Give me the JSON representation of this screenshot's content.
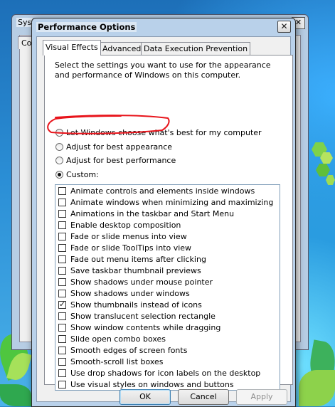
{
  "background_window": {
    "title": "Sys",
    "close_glyph": "✕",
    "tab_fragment": "Co"
  },
  "dialog": {
    "title": "Performance Options",
    "close_glyph": "✕",
    "tabs": [
      {
        "label": "Visual Effects",
        "active": true
      },
      {
        "label": "Advanced",
        "active": false
      },
      {
        "label": "Data Execution Prevention",
        "active": false
      }
    ],
    "description": "Select the settings you want to use for the appearance and performance of Windows on this computer.",
    "radio_options": [
      {
        "label": "Let Windows choose what's best for my computer",
        "checked": false
      },
      {
        "label": "Adjust for best appearance",
        "checked": false
      },
      {
        "label": "Adjust for best performance",
        "checked": false
      },
      {
        "label": "Custom:",
        "checked": true
      }
    ],
    "effects": [
      {
        "label": "Animate controls and elements inside windows",
        "checked": false
      },
      {
        "label": "Animate windows when minimizing and maximizing",
        "checked": false
      },
      {
        "label": "Animations in the taskbar and Start Menu",
        "checked": false
      },
      {
        "label": "Enable desktop composition",
        "checked": false
      },
      {
        "label": "Fade or slide menus into view",
        "checked": false
      },
      {
        "label": "Fade or slide ToolTips into view",
        "checked": false
      },
      {
        "label": "Fade out menu items after clicking",
        "checked": false
      },
      {
        "label": "Save taskbar thumbnail previews",
        "checked": false
      },
      {
        "label": "Show shadows under mouse pointer",
        "checked": false
      },
      {
        "label": "Show shadows under windows",
        "checked": false
      },
      {
        "label": "Show thumbnails instead of icons",
        "checked": true
      },
      {
        "label": "Show translucent selection rectangle",
        "checked": false
      },
      {
        "label": "Show window contents while dragging",
        "checked": false
      },
      {
        "label": "Slide open combo boxes",
        "checked": false
      },
      {
        "label": "Smooth edges of screen fonts",
        "checked": false
      },
      {
        "label": "Smooth-scroll list boxes",
        "checked": false
      },
      {
        "label": "Use drop shadows for icon labels on the desktop",
        "checked": false
      },
      {
        "label": "Use visual styles on windows and buttons",
        "checked": false
      }
    ],
    "buttons": {
      "ok": "OK",
      "cancel": "Cancel",
      "apply": "Apply"
    }
  },
  "colors": {
    "annotation": "#e8141b",
    "title_bar": "#b9d1ea",
    "desktop": "#2a86c8"
  }
}
